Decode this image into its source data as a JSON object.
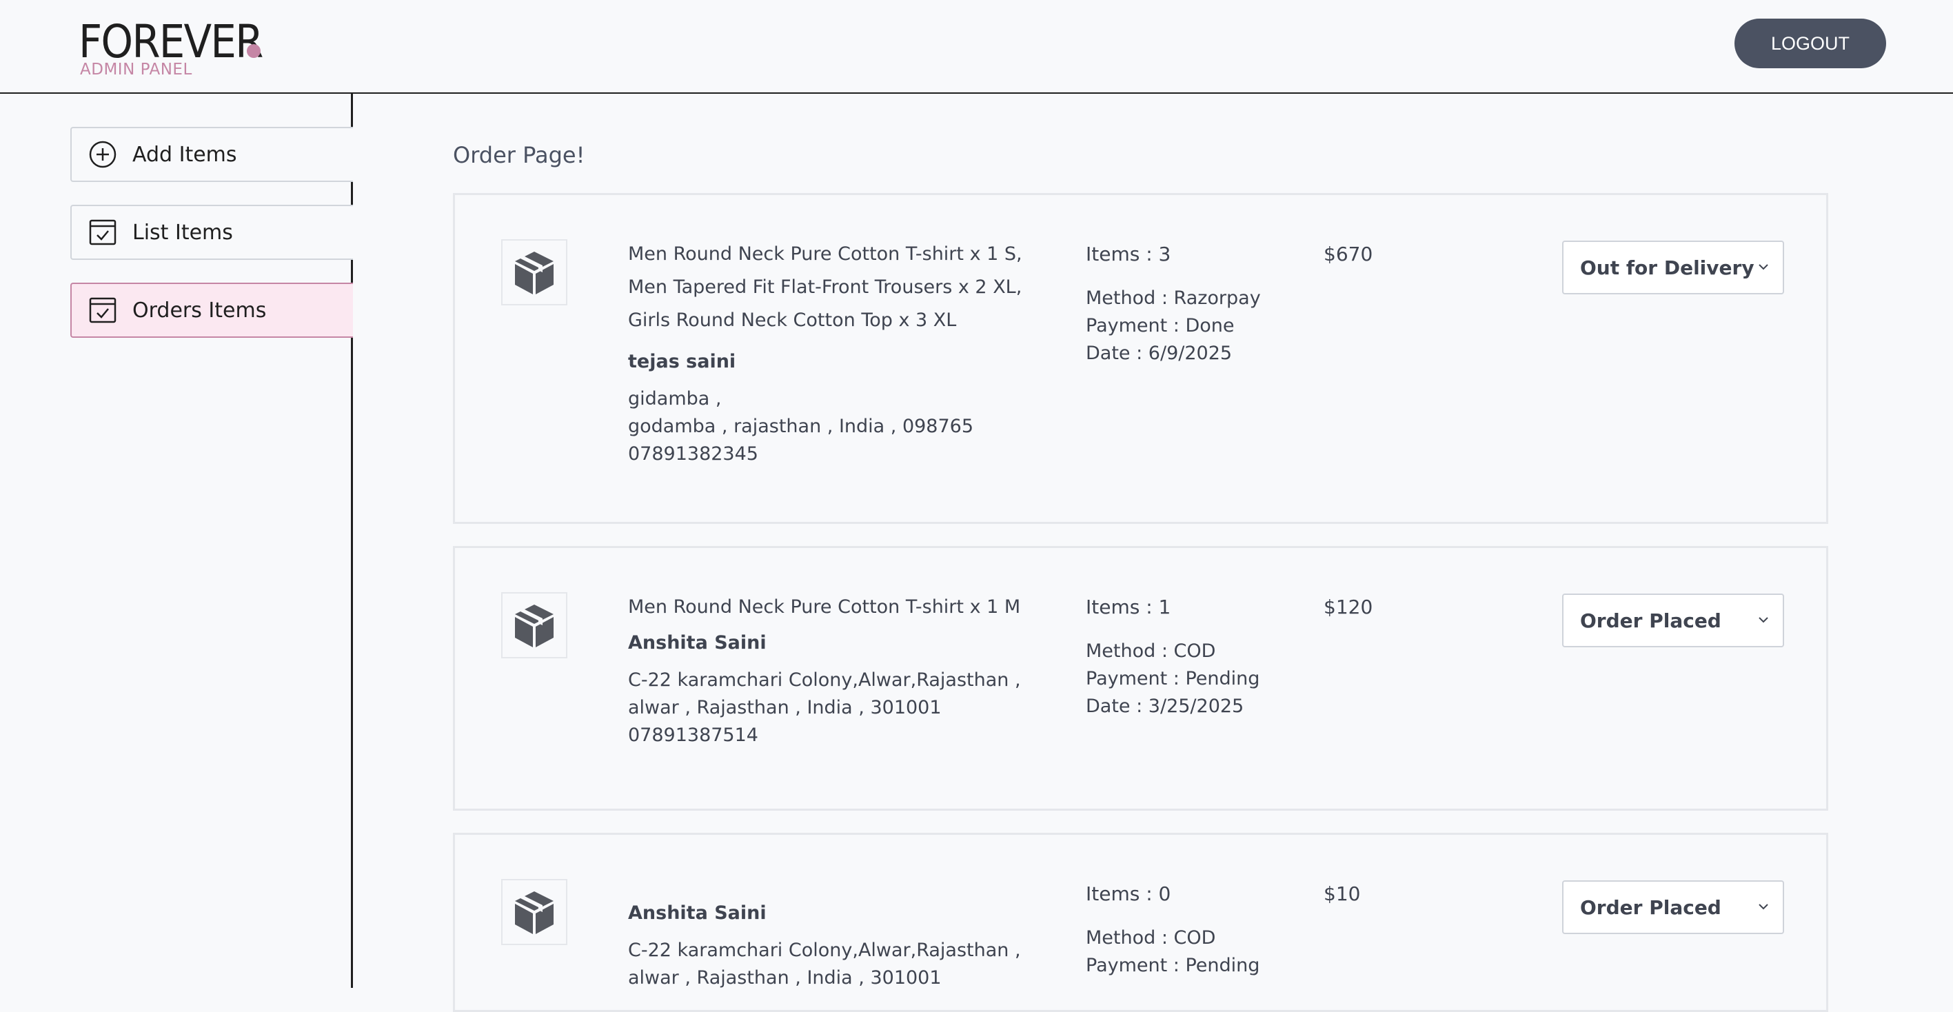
{
  "header": {
    "logo_text": "FOREVER",
    "logo_subtitle": "ADMIN PANEL",
    "logout_label": "LOGOUT"
  },
  "sidebar": {
    "items": [
      {
        "label": "Add Items",
        "icon": "plus-circle-icon",
        "active": false
      },
      {
        "label": "List Items",
        "icon": "checklist-icon",
        "active": false
      },
      {
        "label": "Orders Items",
        "icon": "checklist-icon",
        "active": true
      }
    ]
  },
  "main": {
    "title": "Order Page!",
    "orders": [
      {
        "items": [
          "Men Round Neck Pure Cotton T-shirt x 1 S,",
          "Men Tapered Fit Flat-Front Trousers x 2 XL,",
          "Girls Round Neck Cotton Top x 3 XL"
        ],
        "customer": "tejas saini",
        "address_line1": "gidamba ,",
        "address_line2": "godamba , rajasthan , India , 098765",
        "phone": "07891382345",
        "item_count": "Items : 3",
        "method": "Method : Razorpay",
        "payment": "Payment : Done",
        "date": "Date : 6/9/2025",
        "amount": "$670",
        "status": "Out for Delivery"
      },
      {
        "items": [
          "Men Round Neck Pure Cotton T-shirt x 1 M"
        ],
        "customer": "Anshita Saini",
        "address_line1": "C-22 karamchari Colony,Alwar,Rajasthan ,",
        "address_line2": "alwar , Rajasthan , India , 301001",
        "phone": "07891387514",
        "item_count": "Items : 1",
        "method": "Method : COD",
        "payment": "Payment : Pending",
        "date": "Date : 3/25/2025",
        "amount": "$120",
        "status": "Order Placed"
      },
      {
        "items": [],
        "customer": "Anshita Saini",
        "address_line1": "C-22 karamchari Colony,Alwar,Rajasthan ,",
        "address_line2": "alwar , Rajasthan , India , 301001",
        "item_count": "Items : 0",
        "method": "Method : COD",
        "payment": "Payment : Pending",
        "amount": "$10",
        "status": "Order Placed"
      }
    ]
  }
}
